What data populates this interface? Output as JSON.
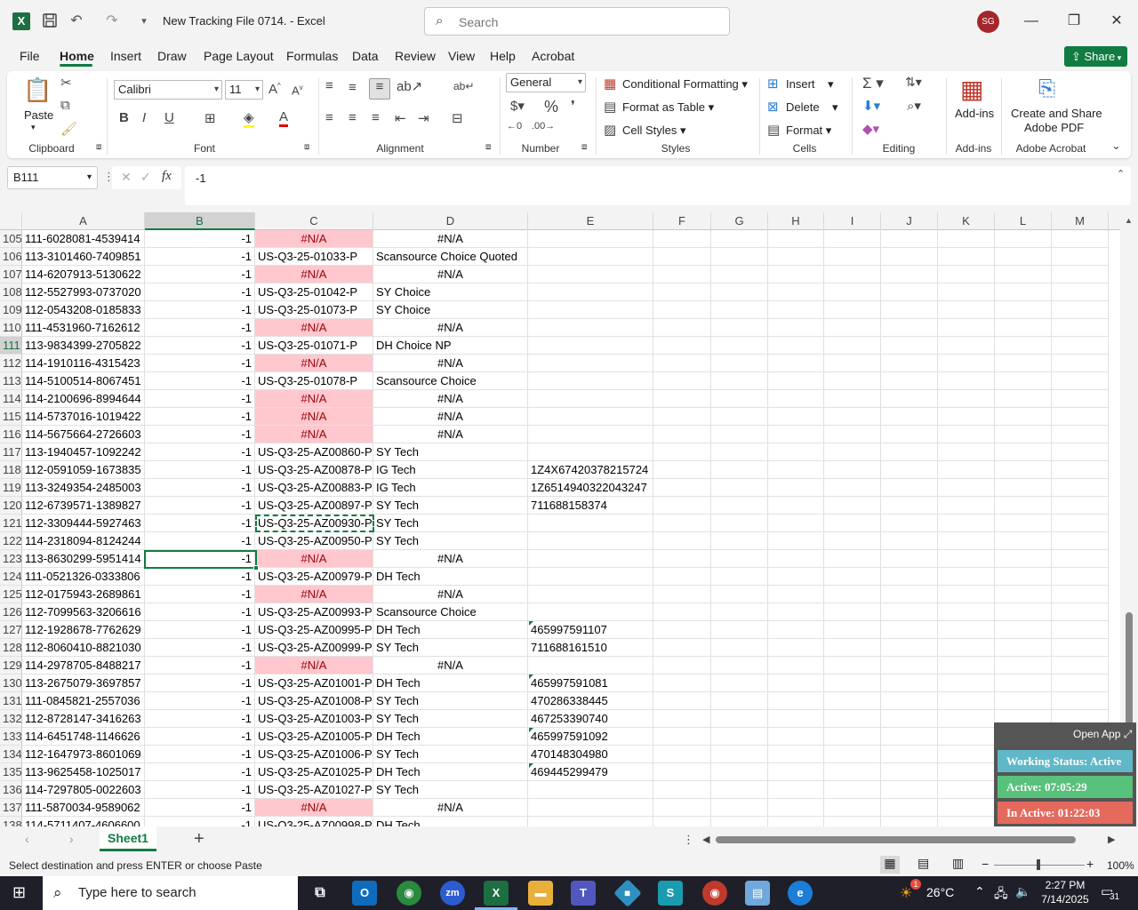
{
  "titlebar": {
    "doc_title": "New Tracking File 0714.  -  Excel",
    "search_placeholder": "Search",
    "avatar_initials": "SG"
  },
  "menu": [
    "File",
    "Home",
    "Insert",
    "Draw",
    "Page Layout",
    "Formulas",
    "Data",
    "Review",
    "View",
    "Help",
    "Acrobat"
  ],
  "share_label": "Share",
  "ribbon": {
    "paste": "Paste",
    "font_name": "Calibri",
    "font_size": "11",
    "number_format": "General",
    "conditional_formatting": "Conditional Formatting",
    "format_as_table": "Format as Table",
    "cell_styles": "Cell Styles",
    "insert": "Insert",
    "delete": "Delete",
    "format": "Format",
    "add_ins": "Add-ins",
    "create_share_1": "Create and Share",
    "create_share_2": "Adobe PDF",
    "groups": {
      "clipboard": "Clipboard",
      "font": "Font",
      "alignment": "Alignment",
      "number": "Number",
      "styles": "Styles",
      "cells": "Cells",
      "editing": "Editing",
      "addins": "Add-ins",
      "acrobat": "Adobe Acrobat"
    }
  },
  "formula_bar": {
    "name_box": "B111",
    "formula": "-1"
  },
  "columns": [
    "A",
    "B",
    "C",
    "D",
    "E",
    "F",
    "G",
    "H",
    "I",
    "J",
    "K",
    "L",
    "M"
  ],
  "rows": [
    {
      "n": "105",
      "a": "111-6028081-4539414",
      "b": "-1",
      "c": "#N/A",
      "d": "#N/A",
      "e": ""
    },
    {
      "n": "106",
      "a": "113-3101460-7409851",
      "b": "-1",
      "c": "US-Q3-25-01033-P",
      "d": "Scansource Choice Quoted",
      "e": ""
    },
    {
      "n": "107",
      "a": "114-6207913-5130622",
      "b": "-1",
      "c": "#N/A",
      "d": "#N/A",
      "e": ""
    },
    {
      "n": "108",
      "a": "112-5527993-0737020",
      "b": "-1",
      "c": "US-Q3-25-01042-P",
      "d": "SY Choice",
      "e": ""
    },
    {
      "n": "109",
      "a": "112-0543208-0185833",
      "b": "-1",
      "c": "US-Q3-25-01073-P",
      "d": "SY Choice",
      "e": ""
    },
    {
      "n": "110",
      "a": "111-4531960-7162612",
      "b": "-1",
      "c": "#N/A",
      "d": "#N/A",
      "e": ""
    },
    {
      "n": "111",
      "a": "113-9834399-2705822",
      "b": "-1",
      "c": "US-Q3-25-01071-P",
      "d": "DH Choice NP",
      "e": ""
    },
    {
      "n": "112",
      "a": "114-1910116-4315423",
      "b": "-1",
      "c": "#N/A",
      "d": "#N/A",
      "e": ""
    },
    {
      "n": "113",
      "a": "114-5100514-8067451",
      "b": "-1",
      "c": "US-Q3-25-01078-P",
      "d": "Scansource Choice",
      "e": ""
    },
    {
      "n": "114",
      "a": "114-2100696-8994644",
      "b": "-1",
      "c": "#N/A",
      "d": "#N/A",
      "e": ""
    },
    {
      "n": "115",
      "a": "114-5737016-1019422",
      "b": "-1",
      "c": "#N/A",
      "d": "#N/A",
      "e": ""
    },
    {
      "n": "116",
      "a": "114-5675664-2726603",
      "b": "-1",
      "c": "#N/A",
      "d": "#N/A",
      "e": ""
    },
    {
      "n": "117",
      "a": "113-1940457-1092242",
      "b": "-1",
      "c": "US-Q3-25-AZ00860-P",
      "d": "SY Tech",
      "e": ""
    },
    {
      "n": "118",
      "a": "112-0591059-1673835",
      "b": "-1",
      "c": "US-Q3-25-AZ00878-P",
      "d": "IG Tech",
      "e": "1Z4X67420378215724"
    },
    {
      "n": "119",
      "a": "113-3249354-2485003",
      "b": "-1",
      "c": "US-Q3-25-AZ00883-P",
      "d": "IG Tech",
      "e": "1Z6514940322043247"
    },
    {
      "n": "120",
      "a": "112-6739571-1389827",
      "b": "-1",
      "c": "US-Q3-25-AZ00897-P",
      "d": "SY Tech",
      "e": "711688158374"
    },
    {
      "n": "121",
      "a": "112-3309444-5927463",
      "b": "-1",
      "c": "US-Q3-25-AZ00930-P",
      "d": "SY Tech",
      "e": ""
    },
    {
      "n": "122",
      "a": "114-2318094-8124244",
      "b": "-1",
      "c": "US-Q3-25-AZ00950-P",
      "d": "SY Tech",
      "e": ""
    },
    {
      "n": "123",
      "a": "113-8630299-5951414",
      "b": "-1",
      "c": "#N/A",
      "d": "#N/A",
      "e": ""
    },
    {
      "n": "124",
      "a": "111-0521326-0333806",
      "b": "-1",
      "c": "US-Q3-25-AZ00979-P",
      "d": "DH Tech",
      "e": ""
    },
    {
      "n": "125",
      "a": "112-0175943-2689861",
      "b": "-1",
      "c": "#N/A",
      "d": "#N/A",
      "e": ""
    },
    {
      "n": "126",
      "a": "112-7099563-3206616",
      "b": "-1",
      "c": "US-Q3-25-AZ00993-P",
      "d": "Scansource Choice",
      "e": ""
    },
    {
      "n": "127",
      "a": "112-1928678-7762629",
      "b": "-1",
      "c": "US-Q3-25-AZ00995-P",
      "d": "DH Tech",
      "e": "465997591107",
      "tri": true
    },
    {
      "n": "128",
      "a": "112-8060410-8821030",
      "b": "-1",
      "c": "US-Q3-25-AZ00999-P",
      "d": "SY Tech",
      "e": "711688161510"
    },
    {
      "n": "129",
      "a": "114-2978705-8488217",
      "b": "-1",
      "c": "#N/A",
      "d": "#N/A",
      "e": ""
    },
    {
      "n": "130",
      "a": "113-2675079-3697857",
      "b": "-1",
      "c": "US-Q3-25-AZ01001-P",
      "d": "DH Tech",
      "e": "465997591081",
      "tri": true
    },
    {
      "n": "131",
      "a": "111-0845821-2557036",
      "b": "-1",
      "c": "US-Q3-25-AZ01008-P",
      "d": "SY Tech",
      "e": "470286338445"
    },
    {
      "n": "132",
      "a": "112-8728147-3416263",
      "b": "-1",
      "c": "US-Q3-25-AZ01003-P",
      "d": "SY Tech",
      "e": "467253390740"
    },
    {
      "n": "133",
      "a": "114-6451748-1146626",
      "b": "-1",
      "c": "US-Q3-25-AZ01005-P",
      "d": "DH Tech",
      "e": "465997591092",
      "tri": true
    },
    {
      "n": "134",
      "a": "112-1647973-8601069",
      "b": "-1",
      "c": "US-Q3-25-AZ01006-P",
      "d": "SY Tech",
      "e": "470148304980"
    },
    {
      "n": "135",
      "a": "113-9625458-1025017",
      "b": "-1",
      "c": "US-Q3-25-AZ01025-P",
      "d": "DH Tech",
      "e": "469445299479",
      "tri": true
    },
    {
      "n": "136",
      "a": "114-7297805-0022603",
      "b": "-1",
      "c": "US-Q3-25-AZ01027-P",
      "d": "SY Tech",
      "e": ""
    },
    {
      "n": "137",
      "a": "111-5870034-9589062",
      "b": "-1",
      "c": "#N/A",
      "d": "#N/A",
      "e": ""
    },
    {
      "n": "138",
      "a": "114-5711407-4606600",
      "b": "-1",
      "c": "US-Q3-25-AZ00998-P",
      "d": "DH Tech",
      "e": ""
    }
  ],
  "sheet_tab": "Sheet1",
  "status": {
    "message": "Select destination and press ENTER or choose Paste",
    "zoom": "100%"
  },
  "widget": {
    "open_app": "Open App",
    "working_status": "Working Status: Active",
    "active": "Active: 07:05:29",
    "inactive": "In Active: 01:22:03"
  },
  "taskbar": {
    "search_placeholder": "Type here to search",
    "temperature": "26°C",
    "time": "2:27 PM",
    "date": "7/14/2025",
    "notification_count": "31",
    "weather_badge": "1"
  },
  "colors": {
    "excel_green": "#107c41",
    "na_fill": "#ffc7ce",
    "na_text": "#9c0006",
    "widget_status": "#5fb7c7",
    "widget_active": "#58c17b",
    "widget_inactive": "#e46a5d"
  }
}
